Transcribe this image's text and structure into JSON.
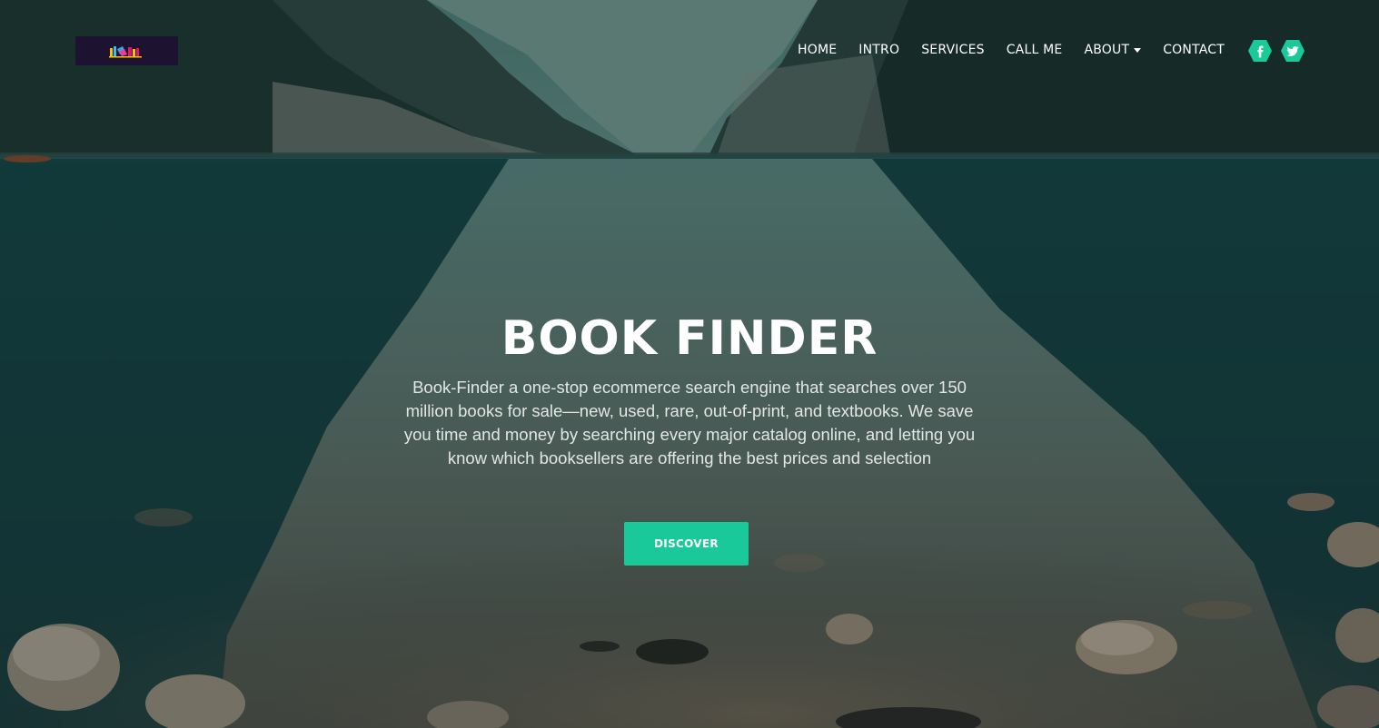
{
  "nav": {
    "items": [
      {
        "label": "HOME",
        "has_dropdown": false
      },
      {
        "label": "INTRO",
        "has_dropdown": false
      },
      {
        "label": "SERVICES",
        "has_dropdown": false
      },
      {
        "label": "CALL ME",
        "has_dropdown": false
      },
      {
        "label": "ABOUT",
        "has_dropdown": true
      },
      {
        "label": "CONTACT",
        "has_dropdown": false
      }
    ],
    "social": [
      {
        "icon": "facebook-icon",
        "glyph": "f"
      },
      {
        "icon": "twitter-icon",
        "glyph": "t"
      }
    ]
  },
  "hero": {
    "title": "BOOK FINDER",
    "description": "Book-Finder a one-stop ecommerce search engine that searches over 150 million books for sale—new, used, rare, out-of-print, and textbooks. We save you time and money by searching every major catalog online, and letting you know which booksellers are offering the best prices and selection",
    "cta_label": "DISCOVER"
  },
  "colors": {
    "accent": "#19c99a",
    "logo_background": "#1d1330",
    "text": "#ffffff"
  }
}
